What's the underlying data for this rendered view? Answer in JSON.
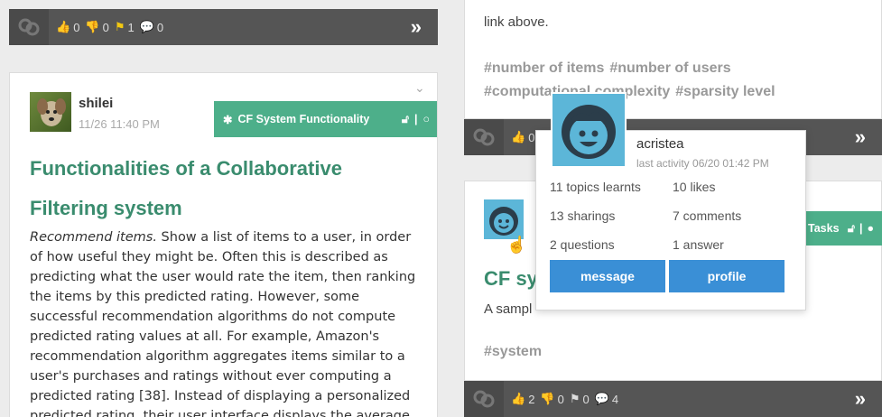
{
  "left_top_bar": {
    "likes": "0",
    "dislikes": "0",
    "flags": "1",
    "comments": "0"
  },
  "left_card": {
    "author": "shilei",
    "time": "11/26 11:40 PM",
    "category": "CF System Functionality",
    "title_line1": "Functionalities of a Collaborative",
    "title_line2": "Filtering system",
    "body_lead": "Recommend items.",
    "body_rest": " Show a list of items to a user, in order of how useful they might be. Often this is described as predicting what the user would rate the item, then ranking the items by this predicted rating. However, some successful recommendation algorithms do not compute predicted rating values at all. For example, Amazon's recommendation algorithm aggregates items similar to a user's purchases and ratings without ever computing a predicted rating [38]. Instead of displaying a personalized predicted rating, their user interface displays the average"
  },
  "right_top_card": {
    "text": "link above.",
    "tags": [
      "#number of items",
      "#number of users",
      "#computational complexity",
      "#sparsity level"
    ]
  },
  "right_mid_bar": {
    "likes": "0"
  },
  "right_bottom_card": {
    "category_partial": "Tasks",
    "title_partial": "CF sy",
    "desc_partial": "A sampl",
    "tag": "#system"
  },
  "right_bottom_bar": {
    "likes": "2",
    "dislikes": "0",
    "flags": "0",
    "comments": "4"
  },
  "popup": {
    "username": "acristea",
    "last_activity": "last activity 06/20 01:42 PM",
    "stats": [
      "11 topics learnts",
      "10 likes",
      "13 sharings",
      "7 comments",
      "2 questions",
      "1 answer"
    ],
    "message_label": "message",
    "profile_label": "profile"
  },
  "colors": {
    "accent_green": "#4daf8a",
    "title_green": "#3a8c6e",
    "button_blue": "#3a8fd6",
    "bar_dark": "#555555",
    "like_red": "#e03030",
    "comment_green": "#4caf50",
    "flag_yellow": "#f2c811"
  }
}
